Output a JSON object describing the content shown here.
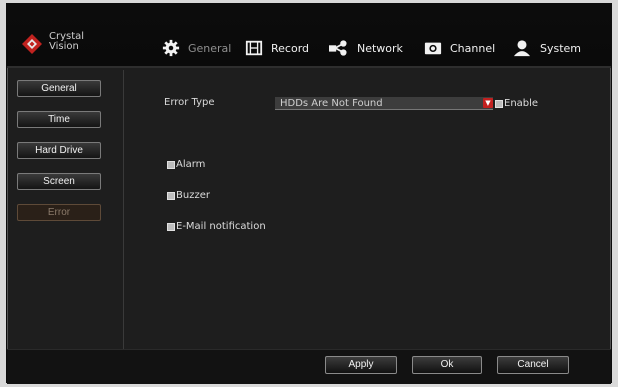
{
  "header": {
    "logo": {
      "line1": "Crystal",
      "line2": "Vision"
    },
    "tabs": [
      {
        "label": "General",
        "icon": "gear-icon",
        "active": true
      },
      {
        "label": "Record",
        "icon": "film-icon",
        "active": false
      },
      {
        "label": "Network",
        "icon": "network-share-icon",
        "active": false
      },
      {
        "label": "Channel",
        "icon": "camera-icon",
        "active": false
      },
      {
        "label": "System",
        "icon": "user-icon",
        "active": false
      }
    ]
  },
  "sidebar": {
    "items": [
      {
        "label": "General",
        "active": false
      },
      {
        "label": "Time",
        "active": false
      },
      {
        "label": "Hard Drive",
        "active": false
      },
      {
        "label": "Screen",
        "active": false
      },
      {
        "label": "Error",
        "active": true
      }
    ]
  },
  "main": {
    "error_type_label": "Error Type",
    "error_type_value": "HDDs Are Not Found",
    "enable_label": "Enable",
    "options": [
      {
        "label": "Alarm"
      },
      {
        "label": "Buzzer"
      },
      {
        "label": "E-Mail notification"
      }
    ]
  },
  "footer": {
    "apply": "Apply",
    "ok": "Ok",
    "cancel": "Cancel"
  },
  "colors": {
    "accent_red": "#c2201f",
    "background": "#1e1e1e"
  }
}
